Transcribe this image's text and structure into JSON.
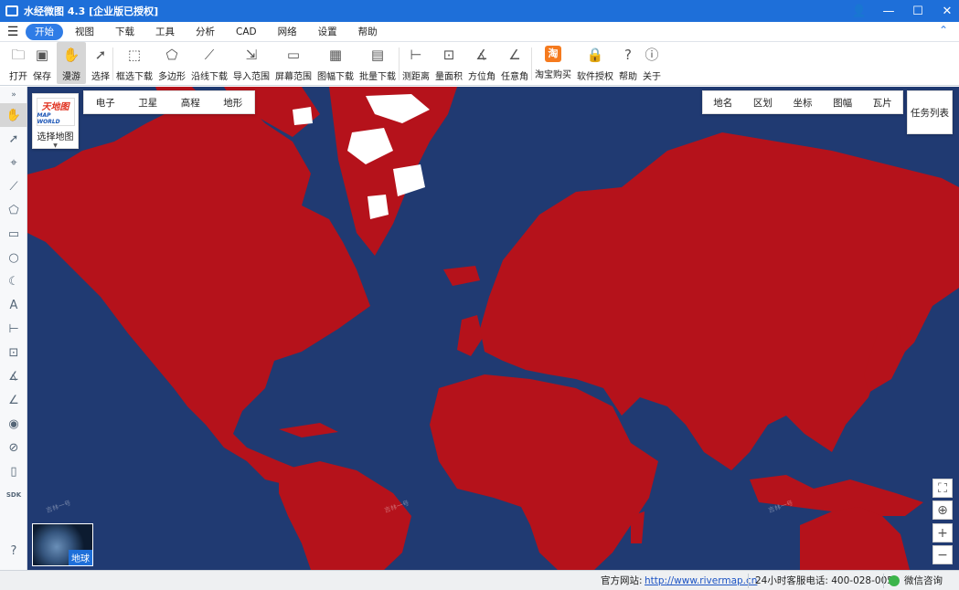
{
  "window": {
    "title": "水经微图 4.3 [企业版已授权]"
  },
  "menu": {
    "items": [
      "开始",
      "视图",
      "下载",
      "工具",
      "分析",
      "CAD",
      "网络",
      "设置",
      "帮助"
    ],
    "active_index": 0
  },
  "toolbar": {
    "items": [
      {
        "label": "打开",
        "icon": "folder-icon"
      },
      {
        "label": "保存",
        "icon": "save-icon"
      },
      {
        "label": "漫游",
        "icon": "hand-icon"
      },
      {
        "label": "选择",
        "icon": "cursor-icon"
      },
      {
        "label": "框选下载",
        "icon": "box-download-icon"
      },
      {
        "label": "多边形",
        "icon": "polygon-download-icon"
      },
      {
        "label": "沿线下载",
        "icon": "line-download-icon"
      },
      {
        "label": "导入范围",
        "icon": "import-range-icon"
      },
      {
        "label": "屏幕范围",
        "icon": "screen-range-icon"
      },
      {
        "label": "图幅下载",
        "icon": "sheet-download-icon"
      },
      {
        "label": "批量下载",
        "icon": "batch-download-icon"
      },
      {
        "label": "测距离",
        "icon": "ruler-icon"
      },
      {
        "label": "量面积",
        "icon": "area-icon"
      },
      {
        "label": "方位角",
        "icon": "azimuth-icon"
      },
      {
        "label": "任意角",
        "icon": "angle-icon"
      },
      {
        "label": "淘宝购买",
        "icon": "taobao-icon",
        "glyph": "淘"
      },
      {
        "label": "软件授权",
        "icon": "lock-icon"
      },
      {
        "label": "帮助",
        "icon": "help-icon"
      },
      {
        "label": "关于",
        "icon": "info-icon"
      }
    ]
  },
  "map": {
    "basemap_label": "选择地图",
    "logo_cn": "天地图",
    "logo_en": "MAP WORLD",
    "map_types": [
      "电子",
      "卫星",
      "高程",
      "地形"
    ],
    "layers": [
      "地名",
      "区划",
      "坐标",
      "图幅",
      "瓦片"
    ],
    "task_list": "任务列表",
    "globe_label": "地球",
    "watermark": "吉林一号",
    "colors": {
      "ocean": "#203a72",
      "land": "#b5121b",
      "ice": "#ffffff"
    }
  },
  "status": {
    "site_label": "官方网站:",
    "site_url": "http://www.rivermap.cn",
    "phone": "24小时客服电话: 400-028-0050",
    "wechat": "微信咨询"
  }
}
